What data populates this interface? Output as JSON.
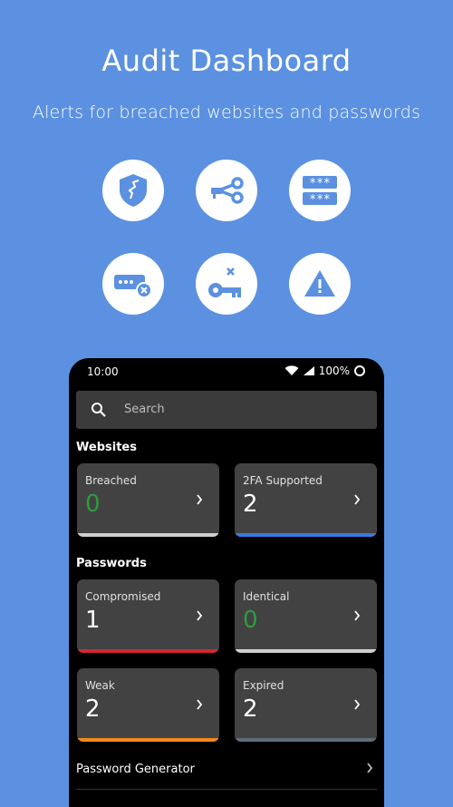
{
  "promo": {
    "headline": "Audit Dashboard",
    "subline": "Alerts for breached websites and passwords"
  },
  "feature_icons": [
    "shield-breach-icon",
    "key-link-icon",
    "password-dots-icon",
    "password-blocked-icon",
    "key-remove-icon",
    "warning-icon"
  ],
  "colors": {
    "background": "#5b91e0",
    "card": "#424242",
    "good": "#2e9b3e",
    "gray_bar": "#cfcfcf",
    "blue_bar": "#3a7be0",
    "red_bar": "#d3272f",
    "orange_bar": "#f0891d",
    "slate_bar": "#5f6c7c"
  },
  "status_bar": {
    "time": "10:00",
    "battery": "100%"
  },
  "search": {
    "placeholder": "Search"
  },
  "websites": {
    "title": "Websites",
    "cards": [
      {
        "label": "Breached",
        "value": "0"
      },
      {
        "label": "2FA Supported",
        "value": "2"
      }
    ]
  },
  "passwords": {
    "title": "Passwords",
    "cards": [
      {
        "label": "Compromised",
        "value": "1"
      },
      {
        "label": "Identical",
        "value": "0"
      },
      {
        "label": "Weak",
        "value": "2"
      },
      {
        "label": "Expired",
        "value": "2"
      }
    ]
  },
  "generator": {
    "label": "Password Generator"
  }
}
